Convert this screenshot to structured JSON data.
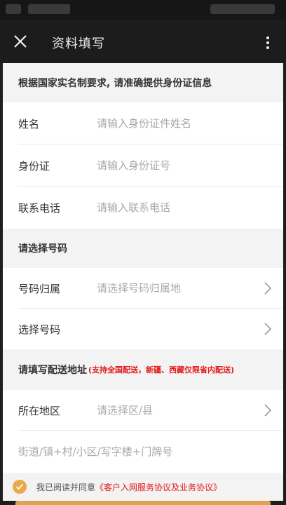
{
  "header": {
    "title": "资料填写"
  },
  "icons": {
    "close": "close-icon",
    "more": "more-vert-icon",
    "chevron": "chevron-right-icon",
    "check": "check-icon"
  },
  "colors": {
    "accent": "#e9a94d",
    "warning_text": "#e41a1a",
    "section_bg": "#f3f3f3",
    "placeholder": "#a8a8a8"
  },
  "identity": {
    "notice": "根据国家实名制要求, 请准确提供身份证信息",
    "name": {
      "label": "姓名",
      "placeholder": "请输入身份证件姓名"
    },
    "id_card": {
      "label": "身份证",
      "placeholder": "请输入身份证号"
    },
    "phone": {
      "label": "联系电话",
      "placeholder": "请输入联系电话"
    }
  },
  "number": {
    "heading": "请选择号码",
    "region": {
      "label": "号码归属",
      "placeholder": "请选择号码归属地"
    },
    "pick": {
      "label": "选择号码"
    }
  },
  "delivery": {
    "heading": "请填写配送地址",
    "note": "(支持全国配送，新疆、西藏仅限省内配送)",
    "area": {
      "label": "所在地区",
      "placeholder": "请选择区/县"
    },
    "street": {
      "placeholder": "街道/镇+村/小区/写字楼+门牌号"
    }
  },
  "agreement": {
    "prefix": "我已阅读并同意",
    "link": "《客户入网服务协议及业务协议》"
  }
}
